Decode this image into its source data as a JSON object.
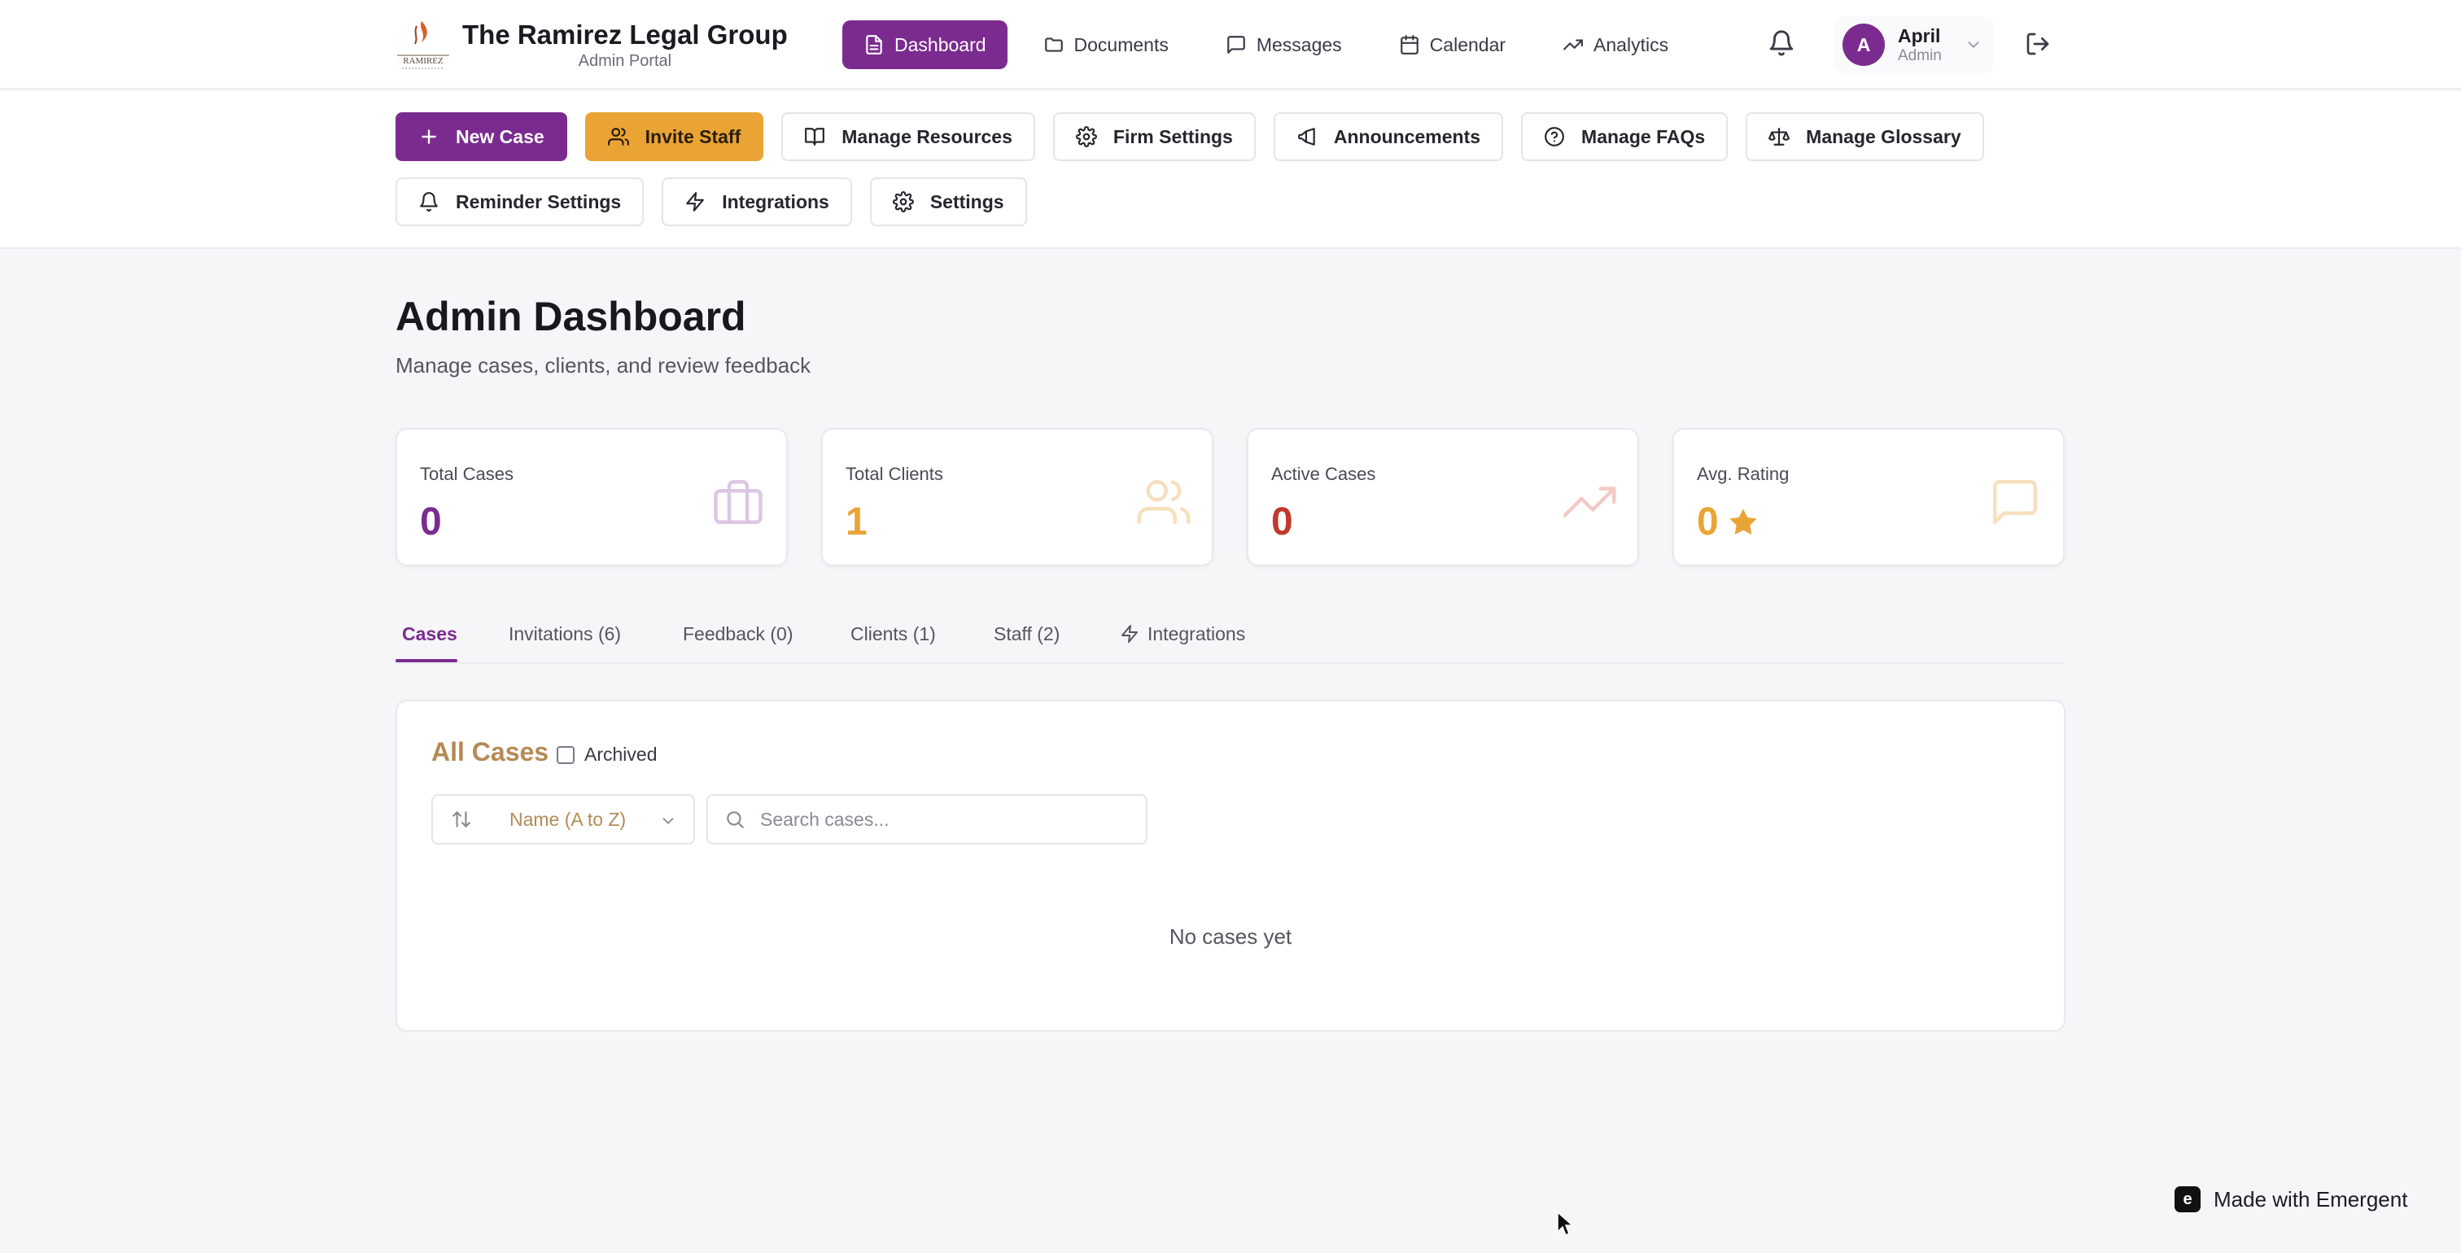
{
  "colors": {
    "brand_purple": "#7b2b8f",
    "accent_amber": "#eaa436",
    "cases_value": "#7b2b8f",
    "clients_value": "#eaa436",
    "active_value": "#c0392b",
    "rating_value": "#eaa436",
    "panel_title": "#b48a55"
  },
  "header": {
    "firm_name": "The Ramirez Legal Group",
    "subtitle": "Admin Portal",
    "logo_text": "RAMIREZ"
  },
  "nav": {
    "items": [
      {
        "label": "Dashboard",
        "icon": "document-icon",
        "active": true
      },
      {
        "label": "Documents",
        "icon": "folder-icon"
      },
      {
        "label": "Messages",
        "icon": "message-icon"
      },
      {
        "label": "Calendar",
        "icon": "calendar-icon"
      },
      {
        "label": "Analytics",
        "icon": "trend-icon"
      }
    ]
  },
  "user": {
    "initial": "A",
    "name": "April",
    "role": "Admin"
  },
  "toolbar": {
    "new_case": "New Case",
    "invite_staff": "Invite Staff",
    "manage_resources": "Manage Resources",
    "firm_settings": "Firm Settings",
    "announcements": "Announcements",
    "manage_faqs": "Manage FAQs",
    "manage_glossary": "Manage Glossary",
    "reminder_settings": "Reminder Settings",
    "integrations": "Integrations",
    "settings": "Settings"
  },
  "page": {
    "title": "Admin Dashboard",
    "subtitle": "Manage cases, clients, and review feedback"
  },
  "stats": [
    {
      "label": "Total Cases",
      "value": "0",
      "icon": "briefcase-icon"
    },
    {
      "label": "Total Clients",
      "value": "1",
      "icon": "users-icon"
    },
    {
      "label": "Active Cases",
      "value": "0",
      "icon": "trending-up-icon"
    },
    {
      "label": "Avg. Rating",
      "value": "0",
      "icon": "chat-icon"
    }
  ],
  "tabs": [
    {
      "label": "Cases",
      "active": true
    },
    {
      "label": "Invitations (6)"
    },
    {
      "label": "Feedback (0)"
    },
    {
      "label": "Clients (1)"
    },
    {
      "label": "Staff (2)"
    },
    {
      "label": "Integrations",
      "icon": "zap-icon"
    }
  ],
  "cases": {
    "title": "All Cases",
    "archived_label": "Archived",
    "archived_checked": false,
    "sort_value": "Name (A to Z)",
    "search_placeholder": "Search cases...",
    "empty_text": "No cases yet"
  },
  "badge": {
    "text": "Made with Emergent",
    "logo": "e"
  }
}
